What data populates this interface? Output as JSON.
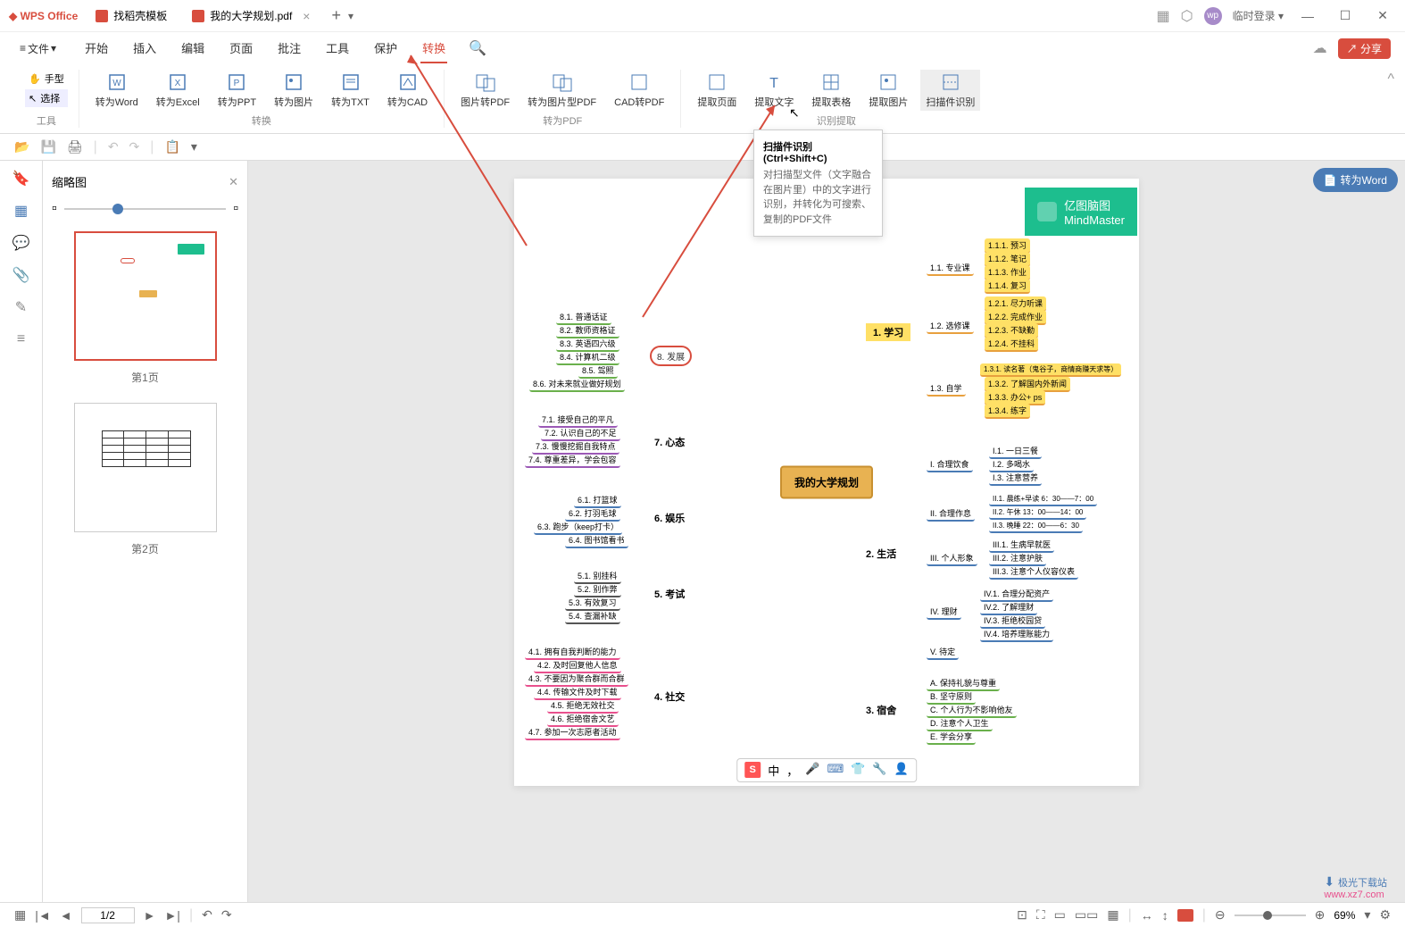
{
  "app_name": "WPS Office",
  "tabs": [
    {
      "label": "找稻壳模板",
      "active": false
    },
    {
      "label": "我的大学规划.pdf",
      "active": true
    }
  ],
  "login_text": "临时登录",
  "file_menu": "文件",
  "menu_tabs": [
    "开始",
    "插入",
    "编辑",
    "页面",
    "批注",
    "工具",
    "保护",
    "转换"
  ],
  "active_menu_tab": "转换",
  "share": "分享",
  "ribbon": {
    "tools": {
      "hand": "手型",
      "select": "选择",
      "group": "工具"
    },
    "convert": {
      "word": "转为Word",
      "excel": "转为Excel",
      "ppt": "转为PPT",
      "image": "转为图片",
      "txt": "转为TXT",
      "cad": "转为CAD",
      "group": "转换"
    },
    "convert_pdf": {
      "img2pdf": "图片转PDF",
      "img2pdf_type": "转为图片型PDF",
      "cad2pdf": "CAD转PDF",
      "group": "转为PDF"
    },
    "extract": {
      "page": "提取页面",
      "text": "提取文字",
      "table": "提取表格",
      "image": "提取图片",
      "ocr": "扫描件识别",
      "group": "识别提取"
    }
  },
  "tooltip": {
    "title": "扫描件识别 (Ctrl+Shift+C)",
    "desc": "对扫描型文件（文字融合在图片里）中的文字进行识别，并转化为可搜索、复制的PDF文件"
  },
  "thumbnail": {
    "title": "缩略图",
    "page1": "第1页",
    "page2": "第2页"
  },
  "to_word": "转为Word",
  "mindmaster": {
    "title": "亿图脑图",
    "subtitle": "MindMaster"
  },
  "mindmap": {
    "center": "我的大学规划",
    "branch8": {
      "name": "8. 发展",
      "items": [
        "8.1. 普通话证",
        "8.2. 教师资格证",
        "8.3. 英语四六级",
        "8.4. 计算机二级",
        "8.5. 驾照",
        "8.6. 对未来就业做好规划"
      ]
    },
    "branch7": {
      "name": "7. 心态",
      "items": [
        "7.1. 接受自己的平凡",
        "7.2. 认识自己的不足",
        "7.3. 慢慢挖掘自我特点",
        "7.4. 尊重差异，学会包容"
      ]
    },
    "branch6": {
      "name": "6. 娱乐",
      "items": [
        "6.1. 打篮球",
        "6.2. 打羽毛球",
        "6.3. 跑步（keep打卡）",
        "6.4. 图书馆看书"
      ]
    },
    "branch5": {
      "name": "5. 考试",
      "items": [
        "5.1. 别挂科",
        "5.2. 别作弊",
        "5.3. 有效复习",
        "5.4. 查漏补缺"
      ]
    },
    "branch4": {
      "name": "4. 社交",
      "items": [
        "4.1. 拥有自我判断的能力",
        "4.2. 及时回复他人信息",
        "4.3. 不要因为聚合群而合群",
        "4.4. 传输文件及时下载",
        "4.5. 拒绝无效社交",
        "4.6. 拒绝宿舍文艺",
        "4.7. 参加一次志愿者活动"
      ]
    },
    "branch1": {
      "name": "1. 学习",
      "sub": [
        {
          "name": "1.1. 专业课",
          "items": [
            "1.1.1. 预习",
            "1.1.2. 笔记",
            "1.1.3. 作业",
            "1.1.4. 复习"
          ]
        },
        {
          "name": "1.2. 选修课",
          "items": [
            "1.2.1. 尽力听课",
            "1.2.2. 完成作业",
            "1.2.3. 不缺勤",
            "1.2.4. 不挂科"
          ]
        },
        {
          "name": "1.3. 自学",
          "items": [
            "1.3.1. 读名著（鬼谷子，商情商赚天求等）",
            "1.3.2. 了解国内外新闻",
            "1.3.3. 办公+ ps",
            "1.3.4. 练字"
          ]
        }
      ]
    },
    "branch2": {
      "name": "2. 生活",
      "sub": [
        {
          "name": "I. 合理饮食",
          "items": [
            "I.1. 一日三餐",
            "I.2. 多喝水",
            "I.3. 注意营养"
          ]
        },
        {
          "name": "II. 合理作息",
          "items": [
            "II.1. 晨练+早读 6：30——7：00",
            "II.2. 午休 13：00——14：00",
            "II.3. 晚睡 22：00——6：30"
          ]
        },
        {
          "name": "III. 个人形象",
          "items": [
            "III.1. 生病早就医",
            "III.2. 注意护肤",
            "III.3. 注意个人仪容仪表"
          ]
        },
        {
          "name": "IV. 理财",
          "items": [
            "IV.1. 合理分配资产",
            "IV.2. 了解理财",
            "IV.3. 拒绝校园贷",
            "IV.4. 培养理账能力"
          ]
        },
        {
          "name": "V. 待定",
          "items": []
        }
      ]
    },
    "branch3": {
      "name": "3. 宿舍",
      "items": [
        "A. 保持礼貌与尊重",
        "B. 坚守原则",
        "C. 个人行为不影响他友",
        "D. 注意个人卫生",
        "E. 学会分享"
      ]
    }
  },
  "statusbar": {
    "page": "1/2",
    "zoom": "69%"
  },
  "floating_bar": [
    "中",
    "，"
  ],
  "watermark_site": "极光下载站",
  "watermark_url": "www.xz7.com"
}
